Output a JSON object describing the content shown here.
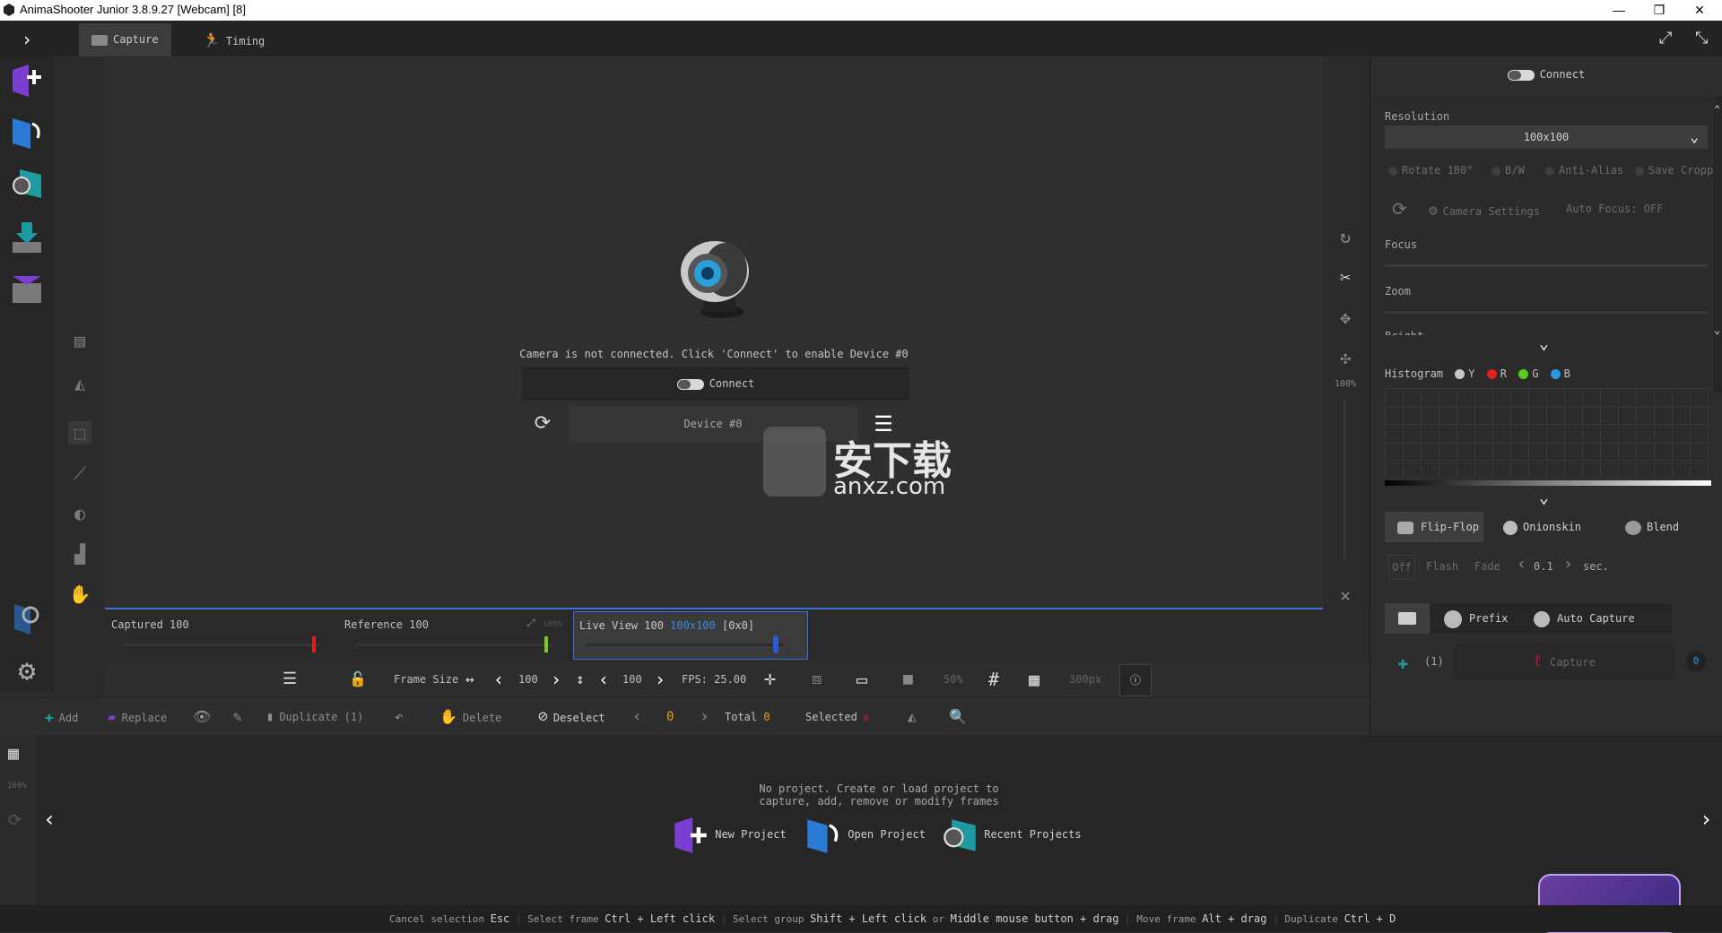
{
  "window": {
    "title": "AnimaShooter Junior 3.8.9.27 [Webcam] [8]",
    "minimize": "—",
    "restore": "❐",
    "close": "✕"
  },
  "tabs": [
    {
      "label": "Capture",
      "active": true
    },
    {
      "label": "Timing",
      "active": false
    }
  ],
  "viewport": {
    "message": "Camera is not connected. Click 'Connect' to enable Device #0",
    "connect_label": "Connect",
    "device_label": "Device #0",
    "watermark_cn": "安下载",
    "watermark_en": "anxz.com"
  },
  "right_strip": {
    "zoom": "100%"
  },
  "right_panel": {
    "connect_label": "Connect",
    "resolution_label": "Resolution",
    "resolution_value": "100x100",
    "options": [
      "Rotate 180°",
      "B/W",
      "Anti-Alias",
      "Save Cropp"
    ],
    "camera_settings": "Camera Settings",
    "auto_focus": "Auto Focus: OFF",
    "focus_label": "Focus",
    "zoom_label": "Zoom",
    "partial_label": "Bright",
    "histogram_label": "Histogram",
    "histogram_channels": [
      {
        "label": "Y",
        "color": "#c8c8c8"
      },
      {
        "label": "R",
        "color": "#e02020"
      },
      {
        "label": "G",
        "color": "#55cc22"
      },
      {
        "label": "B",
        "color": "#2a9ae0"
      }
    ],
    "mode_tabs": [
      "Flip-Flop",
      "Onionskin",
      "Blend"
    ],
    "flip": {
      "off": "Off",
      "flash": "Flash",
      "fade": "Fade",
      "value": "0.1",
      "unit": "sec."
    },
    "prefix_label": "Prefix",
    "auto_capture_label": "Auto Capture",
    "capture_count": "(1)",
    "capture_label": "Capture",
    "capture_badge": "0"
  },
  "status": {
    "captured": "Captured 100",
    "reference": "Reference 100",
    "reference_pct": "100%",
    "liveview": "Live View 100",
    "liveview_res": "100x100",
    "liveview_extra": "[0x0]"
  },
  "toolbar": {
    "frame_size_label": "Frame Size",
    "width": "100",
    "height": "100",
    "fps": "FPS: 25.00",
    "zoom_pct": "50%",
    "grid_px": "300px"
  },
  "actions": {
    "add": "Add",
    "replace": "Replace",
    "duplicate": "Duplicate (1)",
    "delete": "Delete",
    "deselect": "Deselect",
    "frame_index": "0",
    "total_label": "Total",
    "total_value": "0",
    "selected_label": "Selected",
    "selected_value": "0"
  },
  "timeline": {
    "zoom": "100%",
    "message_line1": "No project. Create or load project to",
    "message_line2": "capture, add, remove or modify frames",
    "new_project": "New Project",
    "open_project": "Open Project",
    "recent_projects": "Recent Projects"
  },
  "hints": [
    {
      "label": "Cancel selection",
      "key": "Esc"
    },
    {
      "label": "Select frame",
      "key": "Ctrl + Left click"
    },
    {
      "label": "Select group",
      "key": "Shift + Left click"
    },
    {
      "label": "or",
      "key": "Middle mouse button + drag"
    },
    {
      "label": "Move frame",
      "key": "Alt + drag"
    },
    {
      "label": "Duplicate",
      "key": "Ctrl + D"
    }
  ]
}
